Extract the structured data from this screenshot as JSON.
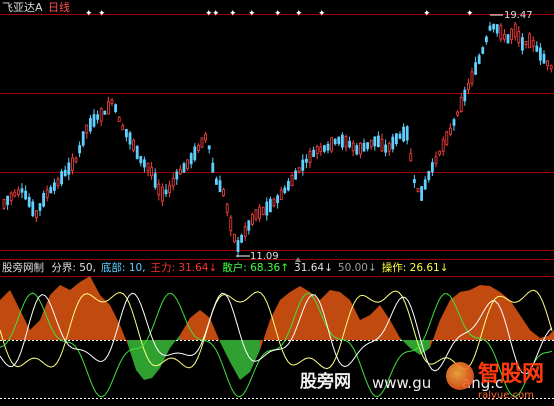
{
  "header": {
    "stock_name": "飞亚达A",
    "period": "日线",
    "color_name": "#dcdcdc",
    "color_period": "#ff5050"
  },
  "price_chart": {
    "high_label": "19.47",
    "low_label": "11.09",
    "up_color": "#ff4040",
    "down_color": "#60d0ff",
    "grid_color": "#a00000",
    "star_color": "#ffffff",
    "star_glyph": "✦"
  },
  "indicator": {
    "name": "股旁网制",
    "items": [
      {
        "key": "分界",
        "sep": ": ",
        "value": "50,",
        "key_color": "#e0e0e0",
        "value_color": "#e0e0e0"
      },
      {
        "key": "底部",
        "sep": ": ",
        "value": "10,",
        "key_color": "#60d0ff",
        "value_color": "#60d0ff"
      },
      {
        "key": "王力",
        "sep": ": ",
        "value": "31.64↓",
        "key_color": "#ff3030",
        "value_color": "#ff3030"
      },
      {
        "key": "散户",
        "sep": ": ",
        "value": "68.36↑",
        "key_color": "#40ff40",
        "value_color": "#40ff40"
      },
      {
        "key": "",
        "sep": "",
        "value": "31.64↓",
        "key_color": "#e0e0e0",
        "value_color": "#e0e0e0"
      },
      {
        "key": "",
        "sep": "",
        "value": "50.00↓",
        "key_color": "#a0a0a0",
        "value_color": "#a0a0a0"
      },
      {
        "key": "操作",
        "sep": ": ",
        "value": "26.61↓",
        "key_color": "#ffff40",
        "value_color": "#ffff40"
      }
    ],
    "fill_positive_color": "#c04a10",
    "fill_negative_color": "#30a030",
    "line_main_color": "#ffff80",
    "line_retail_color": "#40e040",
    "line_white_color": "#ffffff"
  },
  "watermark": {
    "text1": "股旁网",
    "text2": "www.gu",
    "text3": "ang.c",
    "brand": "智股网",
    "url": "ralyue.com"
  }
}
